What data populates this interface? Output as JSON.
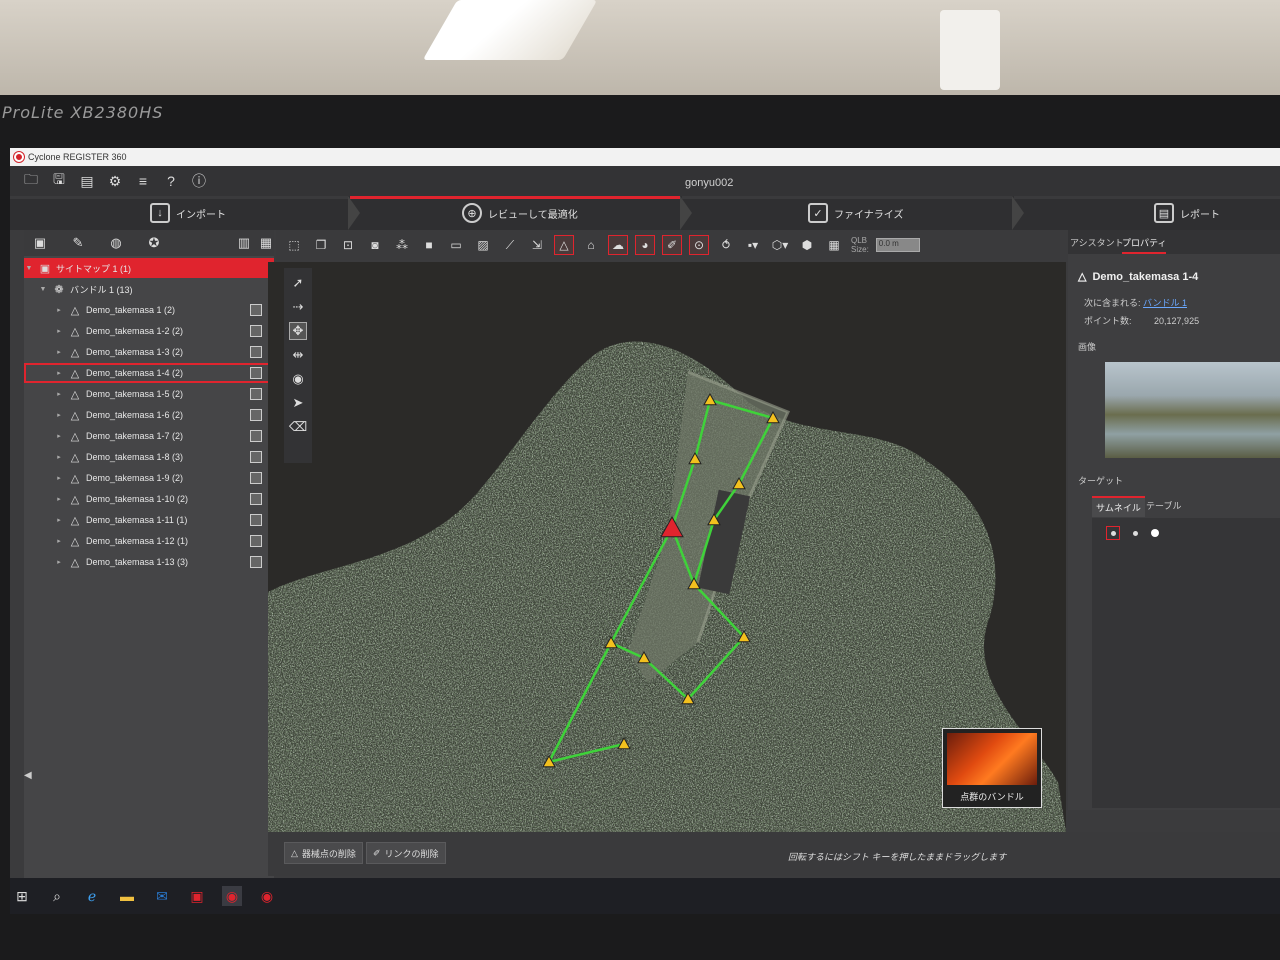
{
  "monitor": {
    "brand": "ProLite XB2380HS"
  },
  "window": {
    "app_title": "Cyclone REGISTER 360",
    "project_name": "gonyu002"
  },
  "toolbar_top": {
    "icons": [
      "folder-open-icon",
      "save-icon",
      "bundle-icon",
      "settings-icon",
      "database-icon",
      "help-icon",
      "info-icon"
    ],
    "glyphs": [
      "🗀",
      "🖫",
      "▤",
      "⚙",
      "≡",
      "?",
      "ⓘ"
    ]
  },
  "workflow": {
    "import_label": "インポート",
    "review_label": "レビューして最適化",
    "finalize_label": "ファイナライズ",
    "report_label": "レポート"
  },
  "left_panel": {
    "sitemap_label": "サイトマップ 1 (1)",
    "bundle_label": "バンドル 1 (13)",
    "setups": [
      "Demo_takemasa 1 (2)",
      "Demo_takemasa 1-2 (2)",
      "Demo_takemasa 1-3 (2)",
      "Demo_takemasa 1-4 (2)",
      "Demo_takemasa 1-5 (2)",
      "Demo_takemasa 1-6 (2)",
      "Demo_takemasa 1-7 (2)",
      "Demo_takemasa 1-8 (3)",
      "Demo_takemasa 1-9 (2)",
      "Demo_takemasa 1-10 (2)",
      "Demo_takemasa 1-11 (1)",
      "Demo_takemasa 1-12 (1)",
      "Demo_takemasa 1-13 (3)"
    ],
    "selected_index": 3
  },
  "view_toolbar": {
    "qlb_label": "QLB",
    "size_label": "Size:",
    "size_value": "0.0 m"
  },
  "viewport": {
    "minimap_label": "点群のバンドル"
  },
  "right_panel": {
    "tab_assistant": "アシスタント",
    "tab_properties": "プロパティ",
    "title": "Demo_takemasa 1-4",
    "included_in_label": "次に含まれる:",
    "included_in_link": "バンドル 1",
    "points_label": "ポイント数:",
    "points_value": "20,127,925",
    "image_label": "画像",
    "target_label": "ターゲット",
    "subtab_thumbnail": "サムネイル",
    "subtab_table": "テーブル"
  },
  "bottom_bar": {
    "delete_setup_button": "器械点の削除",
    "delete_link_button": "リンクの削除",
    "hint": "回転するにはシフト キーを押したままドラッグします"
  },
  "colors": {
    "accent": "#e0242e",
    "link_line": "#3fd23a",
    "setup_marker": "#f2c01e"
  }
}
